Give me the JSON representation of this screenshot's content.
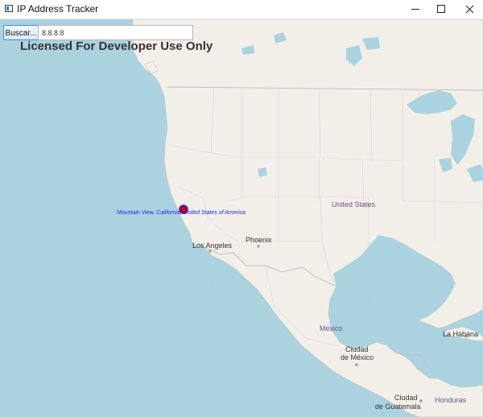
{
  "window": {
    "title": "IP Address Tracker"
  },
  "search": {
    "button_label": "Buscar...",
    "ip_value": "8.8.8.8"
  },
  "watermark": "Licensed For Developer Use Only",
  "marker": {
    "label": "Mountain View, California, United States of America",
    "color": "#1a1aff",
    "fill": "#cc0000"
  },
  "map_labels": [
    {
      "text": "United States",
      "color": "#6b4f86"
    },
    {
      "text": "Los Angeles",
      "color": "#333333"
    },
    {
      "text": "Phoenix",
      "color": "#333333"
    },
    {
      "text": "México",
      "color": "#6b4f86"
    },
    {
      "text": "Ciudad",
      "color": "#333333"
    },
    {
      "text": "de México",
      "color": "#333333"
    },
    {
      "text": "La Habana",
      "color": "#333333"
    },
    {
      "text": "Ciudad",
      "color": "#333333"
    },
    {
      "text": "de Guatemala",
      "color": "#333333"
    },
    {
      "text": "Honduras",
      "color": "#6b4f86"
    }
  ],
  "colors": {
    "water": "#aad3df",
    "land": "#f2efe9",
    "borders": "#c2b5c8"
  }
}
